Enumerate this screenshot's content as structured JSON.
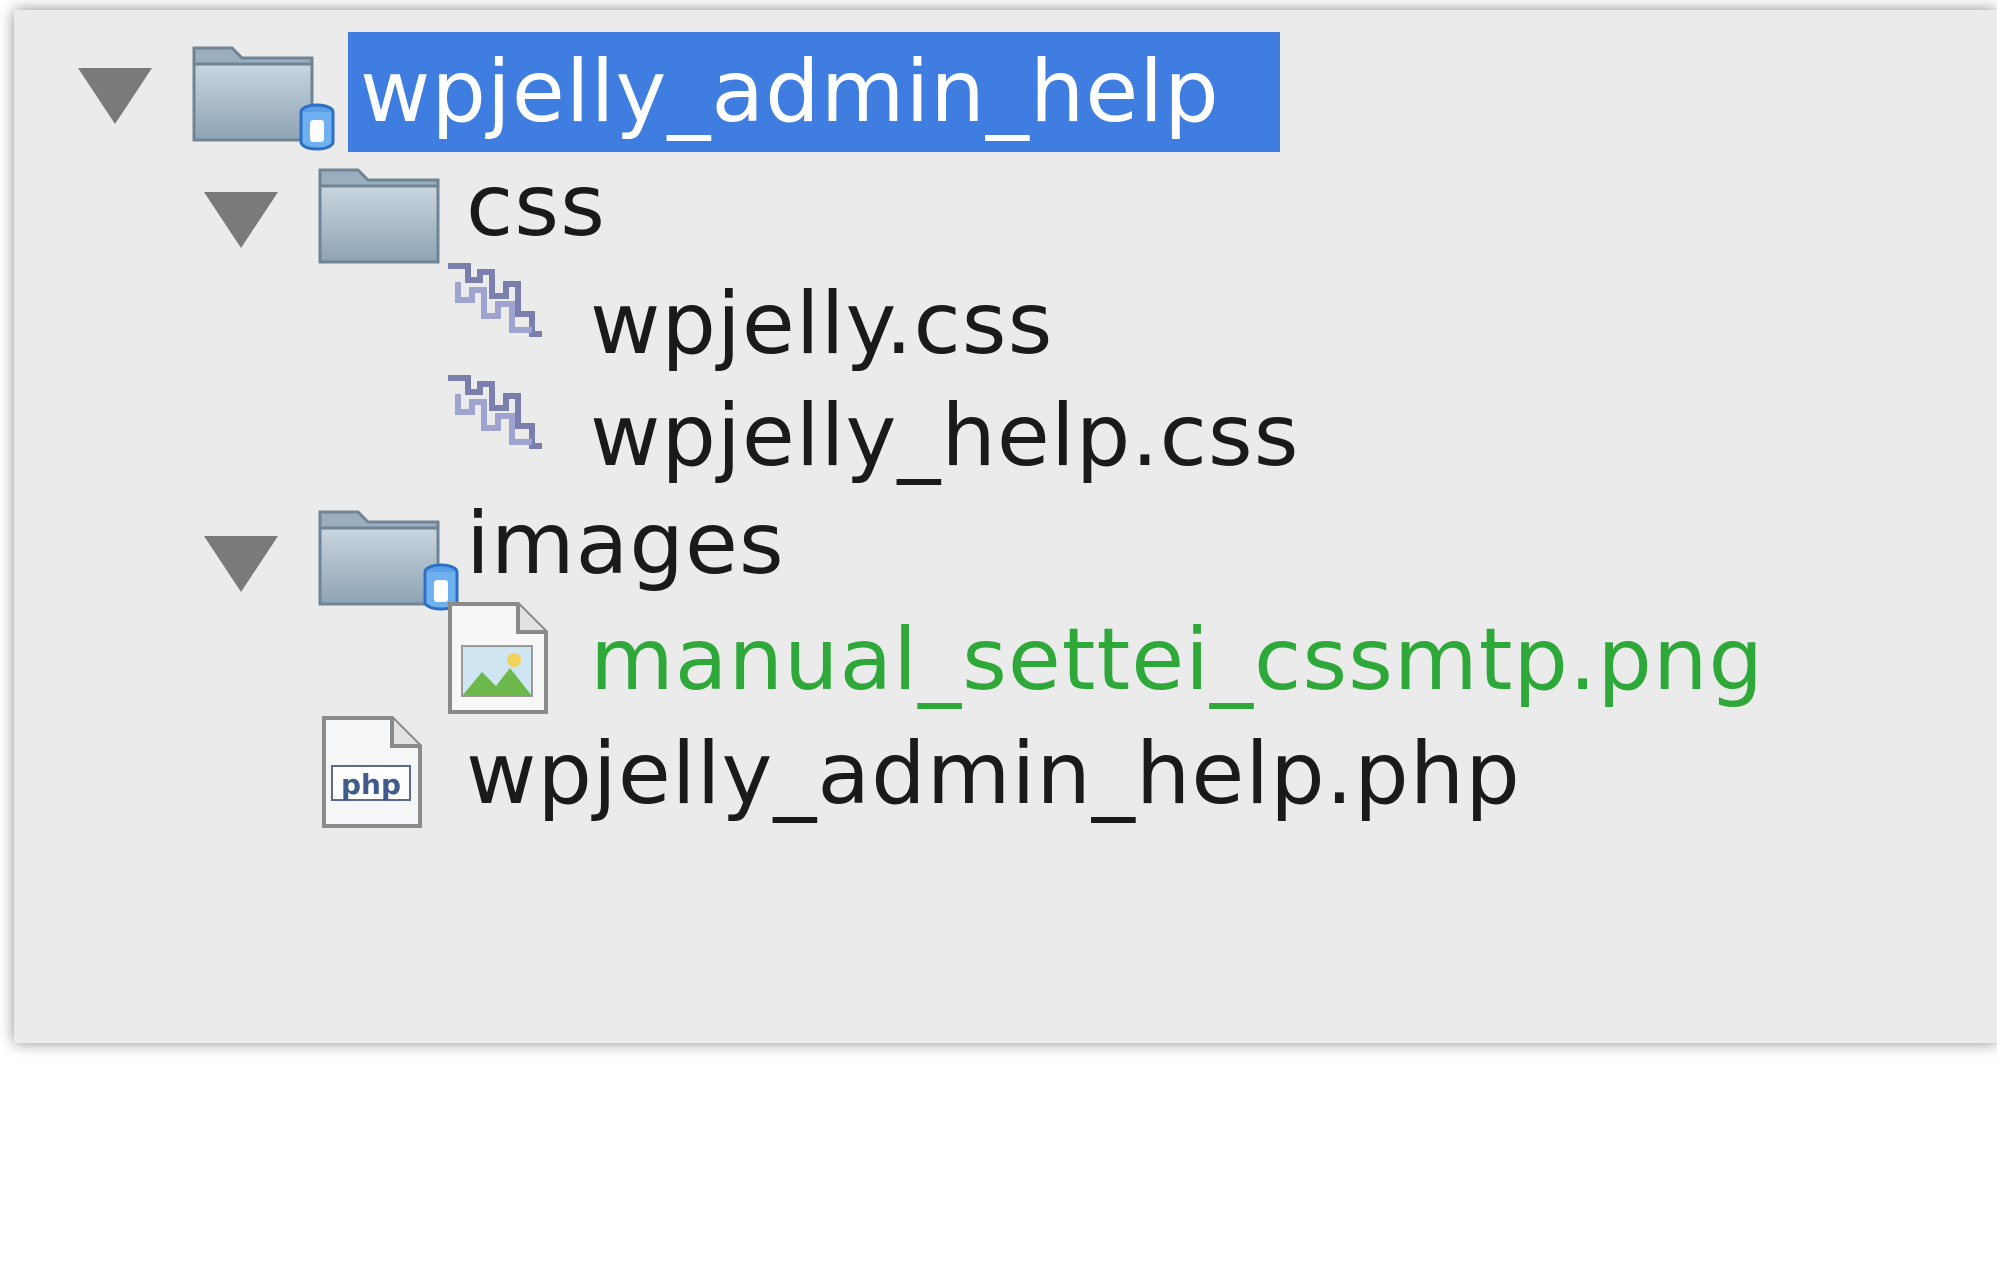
{
  "tree": {
    "root": {
      "label": "wpjelly_admin_help",
      "expanded": true,
      "selected": true,
      "icon": "folder-icon",
      "badge": "versioned-badge-icon"
    },
    "css_folder": {
      "label": "css",
      "expanded": true,
      "icon": "folder-icon"
    },
    "css_files": [
      {
        "label": "wpjelly.css",
        "icon": "css-file-icon"
      },
      {
        "label": "wpjelly_help.css",
        "icon": "css-file-icon"
      }
    ],
    "images_folder": {
      "label": "images",
      "expanded": true,
      "icon": "folder-icon",
      "badge": "versioned-badge-icon"
    },
    "image_files": [
      {
        "label": "manual_settei_cssmtp.png",
        "icon": "image-file-icon",
        "status_color": "#2fa83a"
      }
    ],
    "php_files": [
      {
        "label": "wpjelly_admin_help.php",
        "icon": "php-file-icon"
      }
    ]
  },
  "colors": {
    "selection": "#3f7ee0",
    "panel_background": "#ebebeb",
    "added_file_text": "#2fa83a",
    "disclosure": "#7a7a7a"
  }
}
